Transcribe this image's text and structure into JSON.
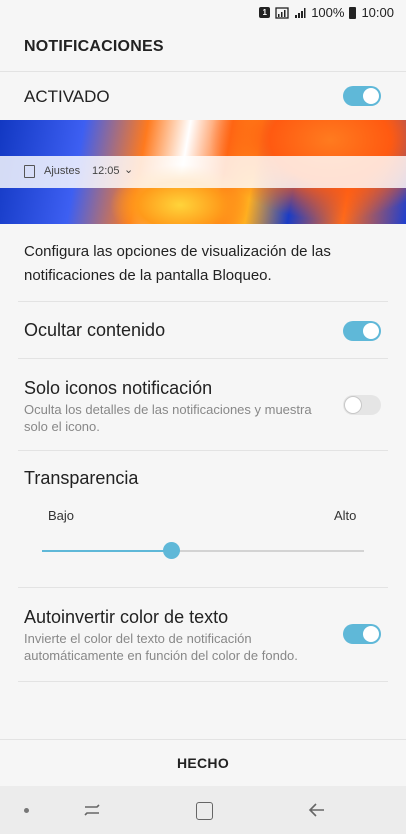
{
  "status_bar": {
    "sim_indicator": "1",
    "battery_percent": "100%",
    "time": "10:00"
  },
  "header": {
    "title": "NOTIFICACIONES"
  },
  "master": {
    "label": "ACTIVADO",
    "enabled": true
  },
  "preview": {
    "app_name": "Ajustes",
    "time": "12:05"
  },
  "description": "Configura las opciones de visualización de las notificaciones de la pantalla Bloqueo.",
  "settings": {
    "hide_content": {
      "title": "Ocultar contenido",
      "enabled": true
    },
    "icons_only": {
      "title": "Solo iconos notificación",
      "subtitle": "Oculta los detalles de las notificaciones y muestra solo el icono.",
      "enabled": false
    },
    "transparency": {
      "title": "Transparencia",
      "low_label": "Bajo",
      "high_label": "Alto",
      "level_fraction": 0.4
    },
    "auto_invert": {
      "title": "Autoinvertir color de texto",
      "subtitle": "Invierte el color del texto de notificación automáticamente en función del color de fondo.",
      "enabled": true
    }
  },
  "footer": {
    "done_label": "HECHO"
  },
  "icons": {
    "status": [
      "sim-icon",
      "wifi-icon",
      "signal-icon",
      "battery-icon"
    ],
    "nav": [
      "dot-icon",
      "recent-apps-icon",
      "home-icon",
      "back-icon"
    ]
  },
  "colors": {
    "accent": "#5fb8d8"
  }
}
